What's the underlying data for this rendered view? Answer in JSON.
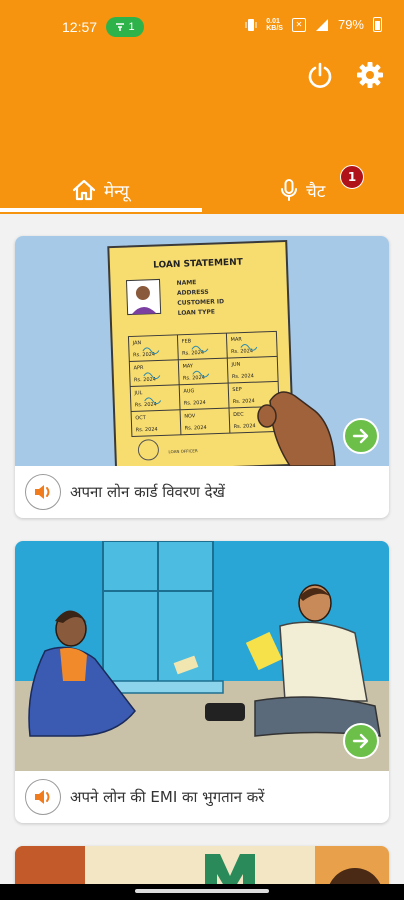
{
  "status": {
    "time": "12:57",
    "pill_count": "1",
    "data_speed_top": "0.01",
    "data_speed_bottom": "KB/S",
    "battery": "79%"
  },
  "header": {
    "power_icon": "power-icon",
    "settings_icon": "gear-icon"
  },
  "tabs": [
    {
      "label": "मेन्यू",
      "icon": "home-icon",
      "active": true
    },
    {
      "label": "चैट",
      "icon": "microphone-icon",
      "badge": "1"
    }
  ],
  "cards": [
    {
      "label": "अपना लोन कार्ड विवरण देखें",
      "image": {
        "title": "LOAN STATEMENT",
        "fields": [
          "NAME",
          "ADDRESS",
          "CUSTOMER ID",
          "LOAN TYPE"
        ],
        "months": [
          {
            "m": "JAN",
            "v": "Rs. 2024"
          },
          {
            "m": "FEB",
            "v": "Rs. 2024"
          },
          {
            "m": "MAR",
            "v": "Rs. 2024"
          },
          {
            "m": "APR",
            "v": "Rs. 2024"
          },
          {
            "m": "MAY",
            "v": "Rs. 2024"
          },
          {
            "m": "JUN",
            "v": "Rs. 2024"
          },
          {
            "m": "JUL",
            "v": "Rs. 2024"
          },
          {
            "m": "AUG",
            "v": "Rs. 2024"
          },
          {
            "m": "SEP",
            "v": "Rs. 2024"
          },
          {
            "m": "OCT",
            "v": "Rs. 2024"
          },
          {
            "m": "NOV",
            "v": "Rs. 2024"
          },
          {
            "m": "DEC",
            "v": "Rs. 2024"
          }
        ],
        "stamp": "LOAN OFFICER"
      }
    },
    {
      "label": "अपने लोन की EMI का भुगतान करें"
    },
    {
      "label": ""
    }
  ],
  "colors": {
    "brand": "#f6930f",
    "badge": "#b01219",
    "next": "#6cc04a",
    "pill": "#2eb34a"
  }
}
